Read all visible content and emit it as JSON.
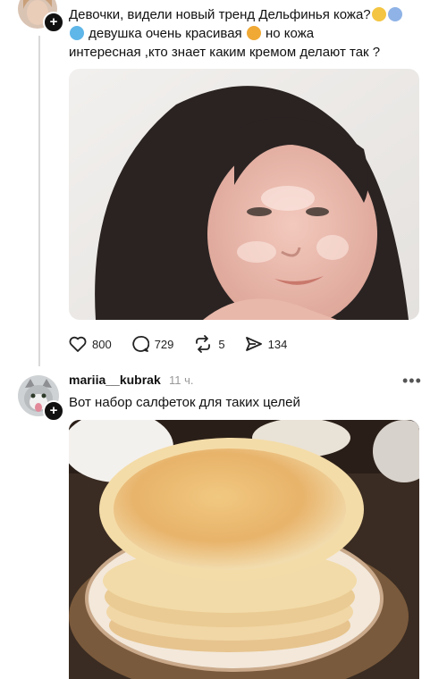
{
  "post1": {
    "avatar_icon": "user-avatar-icon",
    "text_line1": "Девочки, видели новый тренд Дельфинья кожа?",
    "text_line2a": "девушка очень красивая",
    "text_line2b": "но кожа",
    "text_line3": "интересная ,кто знает каким кремом делают так ?",
    "emojis": [
      "face-emoji",
      "shocked-emoji",
      "dolphin-emoji",
      "heart-eyes-emoji"
    ],
    "image": "woman-face-photo",
    "actions": {
      "likes": "800",
      "comments": "729",
      "reposts": "5",
      "shares": "134"
    }
  },
  "post2": {
    "avatar_icon": "cat-avatar-icon",
    "username": "mariia__kubrak",
    "time": "11 ч.",
    "more": "•••",
    "text": "Вот набор салфеток для таких целей",
    "image": "pancakes-photo"
  },
  "colors": {
    "text": "#111111",
    "muted": "#999999",
    "thread_line": "#d9d9d9"
  }
}
